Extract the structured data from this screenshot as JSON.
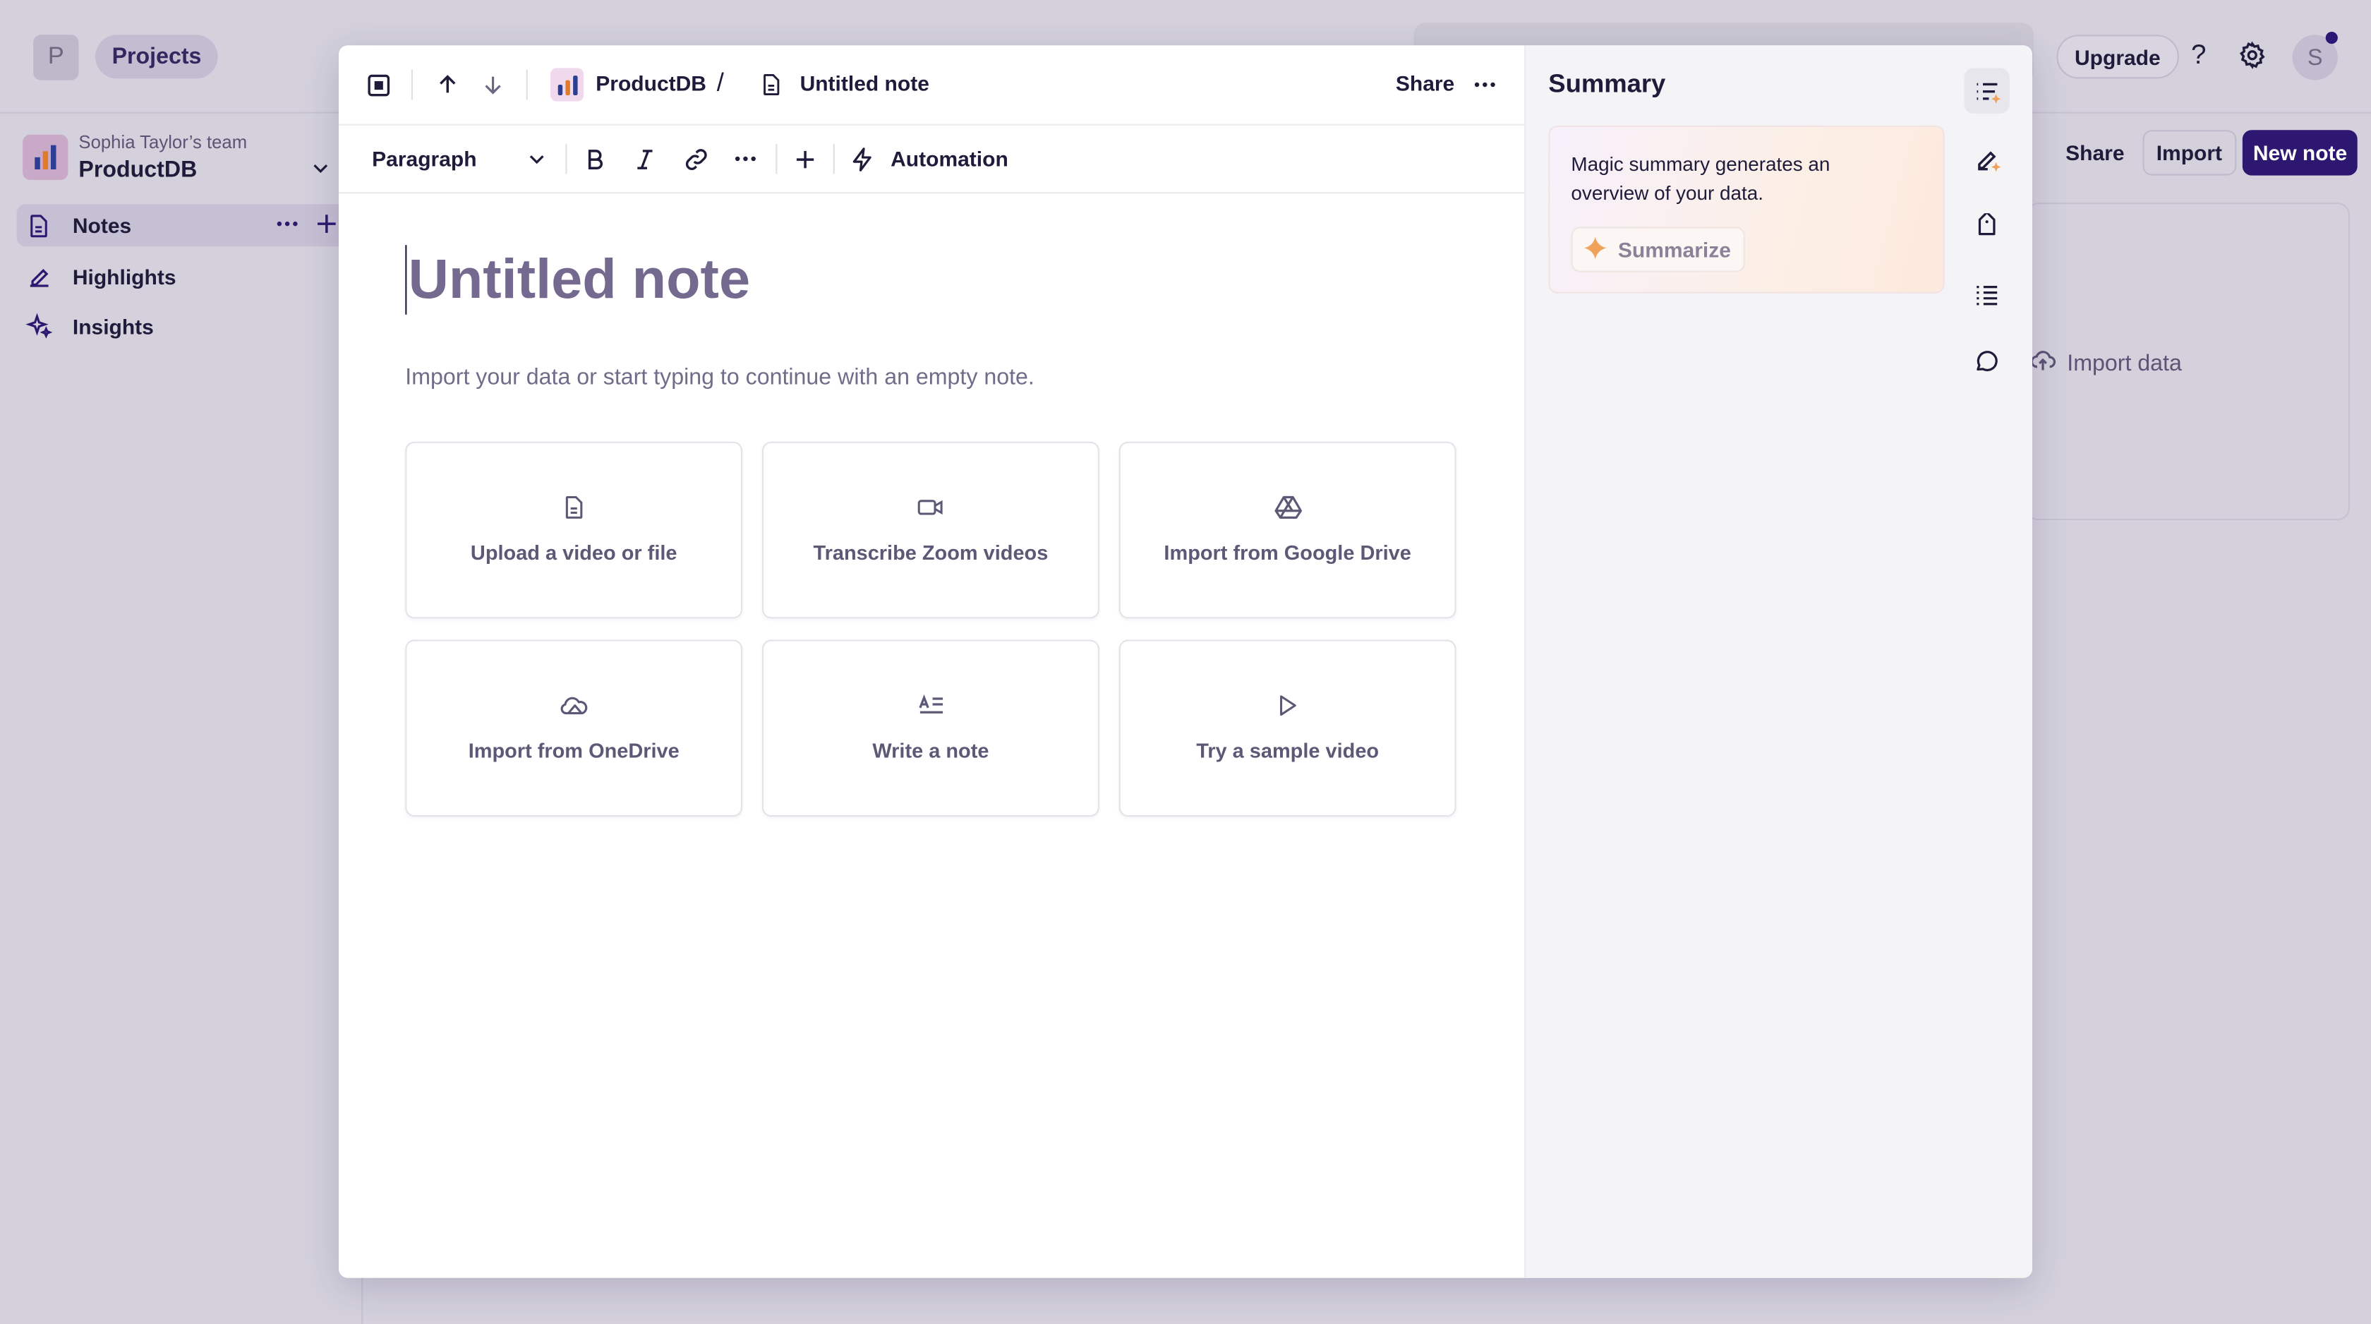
{
  "background": {
    "workspace_initial": "P",
    "projects_label": "Projects",
    "upgrade_label": "Upgrade",
    "help_label": "?",
    "user_initial": "S",
    "team_name": "Sophia Taylor’s team",
    "project_name": "ProductDB",
    "nav": [
      {
        "label": "Notes",
        "icon": "note-icon",
        "active": true
      },
      {
        "label": "Highlights",
        "icon": "highlighter-icon",
        "active": false
      },
      {
        "label": "Insights",
        "icon": "sparkle-icon",
        "active": false
      }
    ],
    "share_label": "Share",
    "import_label": "Import",
    "new_note_label": "New note",
    "import_data_label": "Import data"
  },
  "modal": {
    "breadcrumb": {
      "project": "ProductDB",
      "separator": "/",
      "note": "Untitled note"
    },
    "share_label": "Share",
    "toolbar": {
      "block_type": "Paragraph",
      "automation_label": "Automation"
    },
    "note": {
      "title_placeholder": "Untitled note",
      "hint": "Import your data or start typing to continue with an empty note."
    },
    "options": [
      {
        "label": "Upload a video or file",
        "icon": "file-icon"
      },
      {
        "label": "Transcribe Zoom videos",
        "icon": "video-camera-icon"
      },
      {
        "label": "Import from Google Drive",
        "icon": "google-drive-icon"
      },
      {
        "label": "Import from OneDrive",
        "icon": "onedrive-icon"
      },
      {
        "label": "Write a note",
        "icon": "text-format-icon"
      },
      {
        "label": "Try a sample video",
        "icon": "play-icon"
      }
    ],
    "summary": {
      "title": "Summary",
      "description": "Magic summary generates an overview of your data.",
      "button_label": "Summarize"
    }
  },
  "colors": {
    "brand_dark": "#2d1770",
    "accent_orange": "#f0a25a",
    "overlay_bg": "#d4d1dd"
  }
}
